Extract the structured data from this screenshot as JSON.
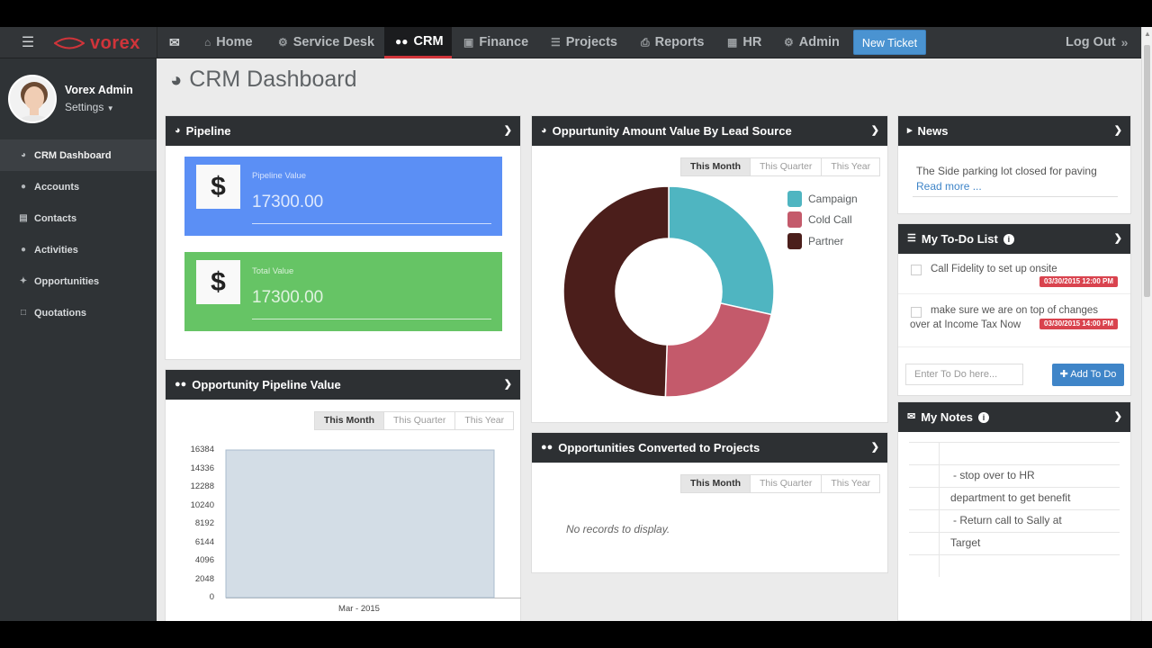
{
  "nav": {
    "brand": "vorex",
    "items": [
      {
        "icon": "envelope-icon",
        "label": ""
      },
      {
        "icon": "home-icon",
        "label": "Home"
      },
      {
        "icon": "sitemap-icon",
        "label": "Service Desk"
      },
      {
        "icon": "users-icon",
        "label": "CRM"
      },
      {
        "icon": "money-icon",
        "label": "Finance"
      },
      {
        "icon": "list-icon",
        "label": "Projects"
      },
      {
        "icon": "print-icon",
        "label": "Reports"
      },
      {
        "icon": "briefcase-icon",
        "label": "HR"
      },
      {
        "icon": "gear-icon",
        "label": "Admin"
      }
    ],
    "new_ticket": "New Ticket",
    "logout": "Log Out"
  },
  "user": {
    "name": "Vorex Admin",
    "settings": "Settings"
  },
  "sidebar": {
    "items": [
      {
        "label": "CRM Dashboard",
        "active": true
      },
      {
        "label": "Accounts"
      },
      {
        "label": "Contacts"
      },
      {
        "label": "Activities"
      },
      {
        "label": "Opportunities"
      },
      {
        "label": "Quotations"
      }
    ]
  },
  "page": {
    "title": "CRM Dashboard"
  },
  "pipeline": {
    "title": "Pipeline",
    "cards": [
      {
        "label": "Pipeline Value",
        "value": "17300.00",
        "color": "#5b8ff5"
      },
      {
        "label": "Total Value",
        "value": "17300.00",
        "color": "#66c465"
      }
    ]
  },
  "filters": [
    "This Month",
    "This Quarter",
    "This Year"
  ],
  "opp_pipeline": {
    "title": "Opportunity Pipeline Value",
    "no_records": ""
  },
  "lead_source": {
    "title": "Oppurtunity Amount Value By Lead Source"
  },
  "converted": {
    "title": "Opportunities Converted to Projects",
    "empty": "No records to display."
  },
  "news": {
    "title": "News",
    "item": "The Side parking lot closed for paving",
    "read_more": "Read more ..."
  },
  "todo": {
    "title": "My To-Do List",
    "items": [
      {
        "line1": "Call Fidelity to set up onsite",
        "line2": "",
        "date": "03/30/2015 12:00 PM"
      },
      {
        "line1": "make sure we are on top of changes",
        "line2": "over at Income Tax Now",
        "date": "03/30/2015 14:00 PM"
      }
    ],
    "placeholder": "Enter To Do here...",
    "add_label": "Add To Do"
  },
  "notes": {
    "title": "My Notes",
    "lines": [
      "- stop over to HR",
      "department to get benefit",
      "- Return call to Sally at",
      "Target"
    ]
  },
  "chart_data": [
    {
      "type": "pie",
      "title": "Oppurtunity Amount Value By Lead Source",
      "categories": [
        "Campaign",
        "Cold Call",
        "Partner"
      ],
      "values": [
        28.5,
        22,
        49.5
      ],
      "colors": [
        "#4fb5c1",
        "#c45a6b",
        "#4b1e1b"
      ],
      "legend": "right"
    },
    {
      "type": "bar",
      "title": "Opportunity Pipeline Value",
      "categories": [
        "Mar - 2015"
      ],
      "values": [
        16384
      ],
      "ylim": [
        0,
        16384
      ],
      "yticks": [
        "16384",
        "14336",
        "12288",
        "10240",
        "8192",
        "6144",
        "4096",
        "2048",
        "0"
      ],
      "color": "#d3dde6"
    }
  ]
}
